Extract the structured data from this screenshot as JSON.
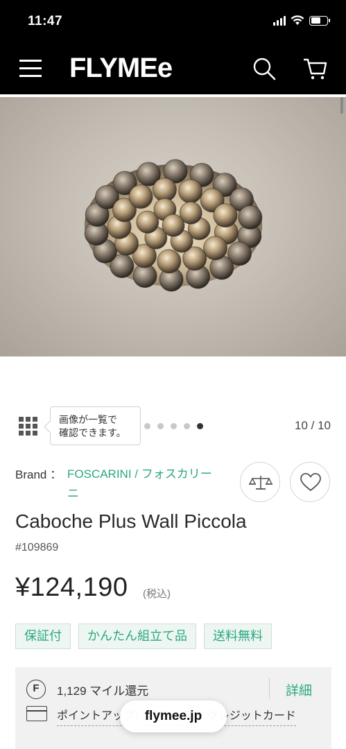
{
  "status_bar": {
    "time": "11:47"
  },
  "header": {
    "logo": "FLYMEe"
  },
  "gallery": {
    "tooltip_line1": "画像が一覧で",
    "tooltip_line2": "確認できます。",
    "counter": "10 / 10",
    "dot_count": 5,
    "active_dot": 5
  },
  "product": {
    "brand_label": "Brand ：",
    "brand_name": "FOSCARINI / フォスカリーニ",
    "title": "Caboche Plus Wall Piccola",
    "sku": "#109869",
    "price": "¥124,190",
    "tax_note": "(税込)",
    "tags": [
      "保証付",
      "かんたん組立て品",
      "送料無料"
    ]
  },
  "miles": {
    "icon_letter": "F",
    "text": "1,129 マイル還元",
    "detail_label": "詳細",
    "points_text": "ポイントアップ！ フライミー クレジットカード"
  },
  "browser": {
    "url": "flymee.jp"
  },
  "colors": {
    "accent": "#2aa882",
    "header_bg": "#000000"
  }
}
